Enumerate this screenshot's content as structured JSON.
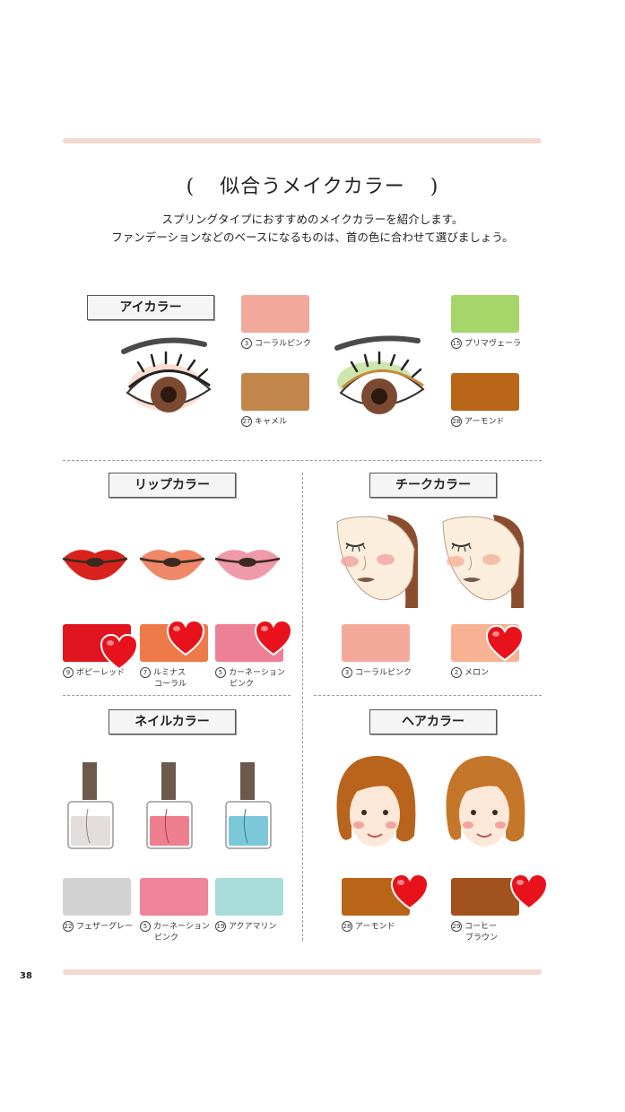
{
  "title": {
    "open": "(",
    "text": "似合うメイクカラー",
    "close": ")"
  },
  "intro": {
    "line1": "スプリングタイプにおすすめのメイクカラーを紹介します。",
    "line2": "ファンデーションなどのベースになるものは、首の色に合わせて選びましょう。"
  },
  "eye": {
    "label": "アイカラー",
    "swatches": [
      {
        "num": "3",
        "name": "コーラルピンク",
        "color": "#f2a89a"
      },
      {
        "num": "27",
        "name": "キャメル",
        "color": "#c0864a"
      },
      {
        "num": "15",
        "name": "プリマヴェーラ",
        "color": "#a6d56a"
      },
      {
        "num": "28",
        "name": "アーモンド",
        "color": "#b96518"
      }
    ]
  },
  "lip": {
    "label": "リップカラー",
    "swatches": [
      {
        "num": "9",
        "name": "ポピーレッド",
        "color": "#e1151f"
      },
      {
        "num": "7",
        "name": "ルミナス",
        "name2": "コーラル",
        "color": "#ee7a4a"
      },
      {
        "num": "5",
        "name": "カーネーション",
        "name2": "ピンク",
        "color": "#ee8095"
      }
    ]
  },
  "cheek": {
    "label": "チークカラー",
    "swatches": [
      {
        "num": "3",
        "name": "コーラルピンク",
        "color": "#f4aa9b"
      },
      {
        "num": "2",
        "name": "メロン",
        "color": "#f6b293"
      }
    ]
  },
  "nail": {
    "label": "ネイルカラー",
    "swatches": [
      {
        "num": "22",
        "name": "フェザーグレー",
        "color": "#d3d3d3"
      },
      {
        "num": "5",
        "name": "カーネーション",
        "name2": "ピンク",
        "color": "#ee8399"
      },
      {
        "num": "19",
        "name": "アクアマリン",
        "color": "#a8ddd9"
      }
    ]
  },
  "hair": {
    "label": "ヘアカラー",
    "swatches": [
      {
        "num": "28",
        "name": "アーモンド",
        "color": "#b96518"
      },
      {
        "num": "29",
        "name": "コーヒー",
        "name2": "ブラウン",
        "color": "#a2521e"
      }
    ]
  },
  "page_number": "38",
  "colors": {
    "rule": "#f4d9d0",
    "heart": "#e8121c"
  }
}
